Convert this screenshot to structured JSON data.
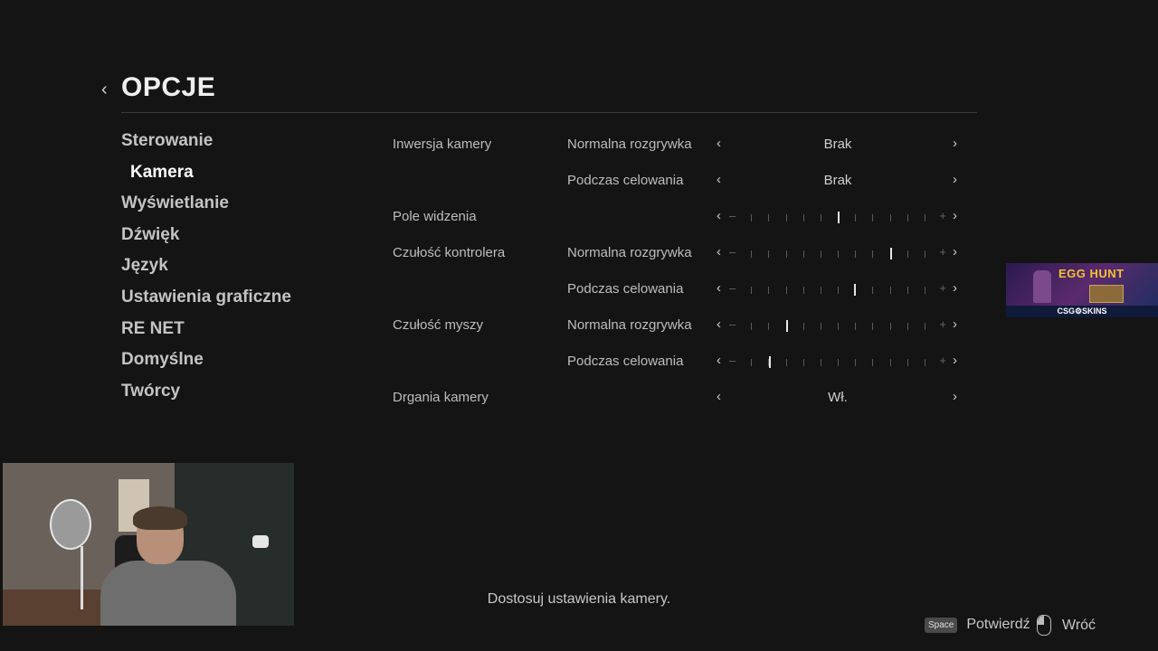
{
  "header": {
    "back_icon": "chevron-left-icon",
    "title": "OPCJE"
  },
  "menu": {
    "items": [
      {
        "label": "Sterowanie",
        "active": false
      },
      {
        "label": "Kamera",
        "active": true
      },
      {
        "label": "Wyświetlanie",
        "active": false
      },
      {
        "label": "Dźwięk",
        "active": false
      },
      {
        "label": "Język",
        "active": false
      },
      {
        "label": "Ustawienia graficzne",
        "active": false
      },
      {
        "label": "RE NET",
        "active": false
      },
      {
        "label": "Domyślne",
        "active": false
      },
      {
        "label": "Twórcy",
        "active": false
      }
    ]
  },
  "settings": [
    {
      "category": "Inwersja kamery",
      "sub": "Normalna rozgrywka",
      "type": "choice",
      "value": "Brak"
    },
    {
      "category": "",
      "sub": "Podczas celowania",
      "type": "choice",
      "value": "Brak"
    },
    {
      "category": "Pole widzenia",
      "sub": "",
      "type": "slider",
      "level": 0.5
    },
    {
      "category": "Czułość kontrolera",
      "sub": "Normalna rozgrywka",
      "type": "slider",
      "level": 0.75
    },
    {
      "category": "",
      "sub": "Podczas celowania",
      "type": "slider",
      "level": 0.58
    },
    {
      "category": "Czułość myszy",
      "sub": "Normalna rozgrywka",
      "type": "slider",
      "level": 0.25
    },
    {
      "category": "",
      "sub": "Podczas celowania",
      "type": "slider",
      "level": 0.17
    },
    {
      "category": "Drgania kamery",
      "sub": "",
      "type": "choice",
      "value": "Wł."
    }
  ],
  "arrows": {
    "left": "‹",
    "right": "›"
  },
  "slider_marks": {
    "minus": "–",
    "plus": "+"
  },
  "description": "Dostosuj ustawienia kamery.",
  "hints": {
    "confirm_key": "Space",
    "confirm_label": "Potwierdź",
    "back_icon": "mouse-right-button-icon",
    "back_label": "Wróć"
  },
  "overlay_ad": {
    "title": "EGG HUNT",
    "brand": "CSG⚙SKINS"
  }
}
